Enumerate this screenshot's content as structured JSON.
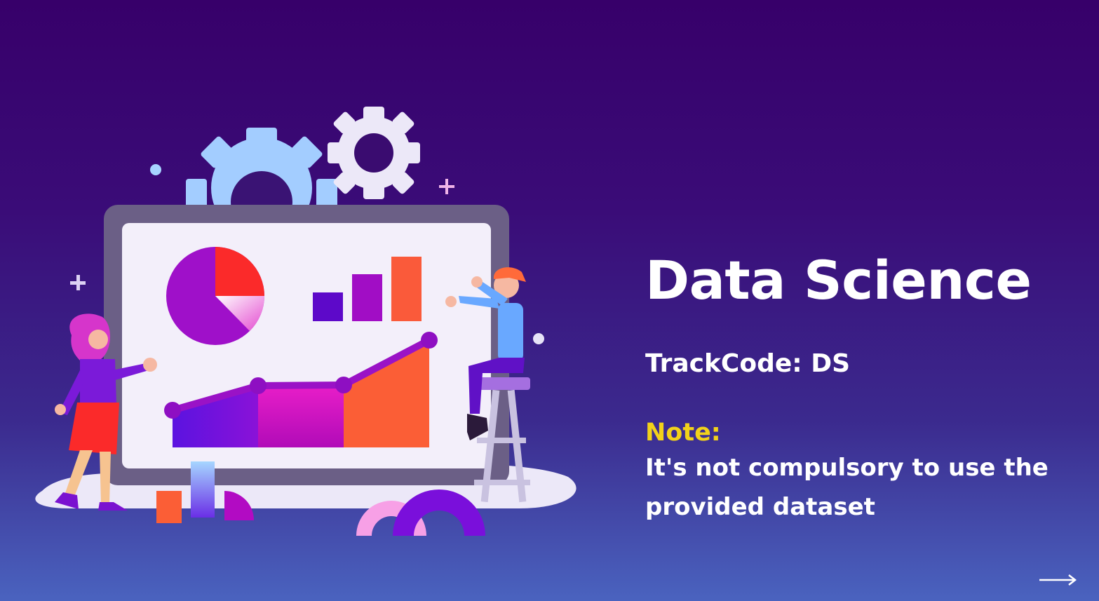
{
  "slide": {
    "title": "Data Science",
    "trackcode": "TrackCode: DS",
    "note_label": "Note:",
    "note_text": "It's not compulsory to use the provided dataset"
  },
  "colors": {
    "background_top": "#37006a",
    "background_bottom": "#4a63bf",
    "text": "#ffffff",
    "accent_note": "#f2d21a"
  },
  "navigation": {
    "next_icon": "arrow-right-icon"
  }
}
